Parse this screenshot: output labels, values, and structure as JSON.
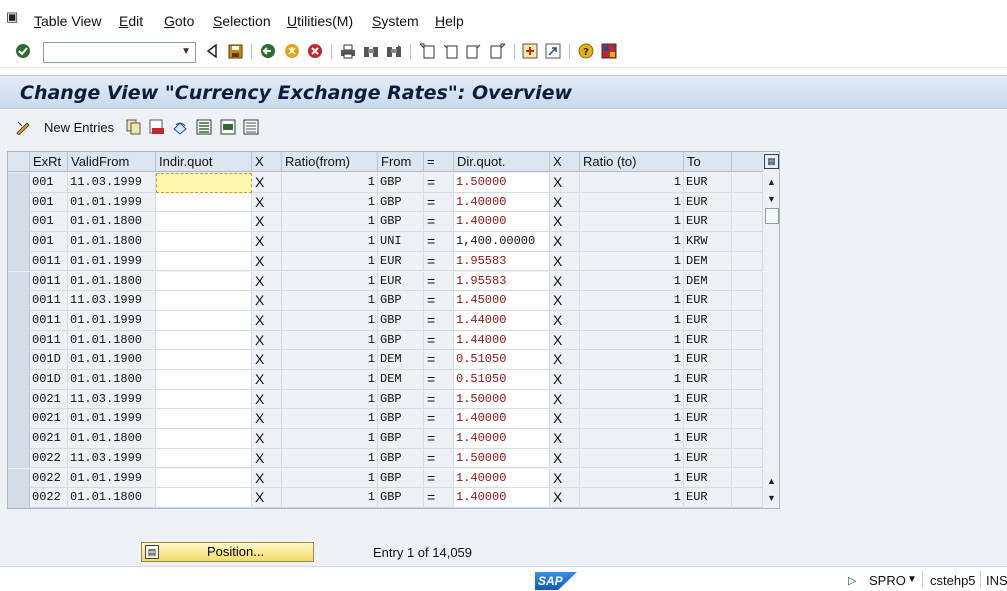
{
  "menu": {
    "items": [
      "Table View",
      "Edit",
      "Goto",
      "Selection",
      "Utilities(M)",
      "System",
      "Help"
    ]
  },
  "toolbar": {
    "command_value": "",
    "icons": [
      "enter-icon",
      "back-icon",
      "save-icon",
      "back-nav-icon",
      "exit-icon",
      "cancel-icon",
      "print-icon",
      "find-icon",
      "find-next-icon",
      "first-page-icon",
      "previous-page-icon",
      "next-page-icon",
      "last-page-icon",
      "create-session-icon",
      "shortcut-icon",
      "help-icon",
      "layout-icon"
    ]
  },
  "title": "Change View \"Currency Exchange Rates\": Overview",
  "app_toolbar": {
    "new_entries_label": "New Entries"
  },
  "table": {
    "headers": [
      "ExRt",
      "ValidFrom",
      "Indir.quot",
      "X",
      "Ratio(from)",
      "From",
      "=",
      "Dir.quot.",
      "X",
      "Ratio (to)",
      "To"
    ],
    "rows": [
      {
        "exrt": "001",
        "valid": "11.03.1999",
        "indir": "",
        "x1": "X",
        "ratio_from": "1",
        "from": "GBP",
        "eq": "=",
        "dir": "1.50000",
        "x2": "X",
        "ratio_to": "1",
        "to": "EUR"
      },
      {
        "exrt": "001",
        "valid": "01.01.1999",
        "indir": "",
        "x1": "X",
        "ratio_from": "1",
        "from": "GBP",
        "eq": "=",
        "dir": "1.40000",
        "x2": "X",
        "ratio_to": "1",
        "to": "EUR"
      },
      {
        "exrt": "001",
        "valid": "01.01.1800",
        "indir": "",
        "x1": "X",
        "ratio_from": "1",
        "from": "GBP",
        "eq": "=",
        "dir": "1.40000",
        "x2": "X",
        "ratio_to": "1",
        "to": "EUR"
      },
      {
        "exrt": "001",
        "valid": "01.01.1800",
        "indir": "",
        "x1": "X",
        "ratio_from": "1",
        "from": "UNI",
        "eq": "=",
        "dir": "1,400.00000",
        "x2": "X",
        "ratio_to": "1",
        "to": "KRW"
      },
      {
        "exrt": "0011",
        "valid": "01.01.1999",
        "indir": "",
        "x1": "X",
        "ratio_from": "1",
        "from": "EUR",
        "eq": "=",
        "dir": "1.95583",
        "x2": "X",
        "ratio_to": "1",
        "to": "DEM"
      },
      {
        "exrt": "0011",
        "valid": "01.01.1800",
        "indir": "",
        "x1": "X",
        "ratio_from": "1",
        "from": "EUR",
        "eq": "=",
        "dir": "1.95583",
        "x2": "X",
        "ratio_to": "1",
        "to": "DEM"
      },
      {
        "exrt": "0011",
        "valid": "11.03.1999",
        "indir": "",
        "x1": "X",
        "ratio_from": "1",
        "from": "GBP",
        "eq": "=",
        "dir": "1.45000",
        "x2": "X",
        "ratio_to": "1",
        "to": "EUR"
      },
      {
        "exrt": "0011",
        "valid": "01.01.1999",
        "indir": "",
        "x1": "X",
        "ratio_from": "1",
        "from": "GBP",
        "eq": "=",
        "dir": "1.44000",
        "x2": "X",
        "ratio_to": "1",
        "to": "EUR"
      },
      {
        "exrt": "0011",
        "valid": "01.01.1800",
        "indir": "",
        "x1": "X",
        "ratio_from": "1",
        "from": "GBP",
        "eq": "=",
        "dir": "1.44000",
        "x2": "X",
        "ratio_to": "1",
        "to": "EUR"
      },
      {
        "exrt": "001D",
        "valid": "01.01.1900",
        "indir": "",
        "x1": "X",
        "ratio_from": "1",
        "from": "DEM",
        "eq": "=",
        "dir": "0.51050",
        "x2": "X",
        "ratio_to": "1",
        "to": "EUR"
      },
      {
        "exrt": "001D",
        "valid": "01.01.1800",
        "indir": "",
        "x1": "X",
        "ratio_from": "1",
        "from": "DEM",
        "eq": "=",
        "dir": "0.51050",
        "x2": "X",
        "ratio_to": "1",
        "to": "EUR"
      },
      {
        "exrt": "0021",
        "valid": "11.03.1999",
        "indir": "",
        "x1": "X",
        "ratio_from": "1",
        "from": "GBP",
        "eq": "=",
        "dir": "1.50000",
        "x2": "X",
        "ratio_to": "1",
        "to": "EUR"
      },
      {
        "exrt": "0021",
        "valid": "01.01.1999",
        "indir": "",
        "x1": "X",
        "ratio_from": "1",
        "from": "GBP",
        "eq": "=",
        "dir": "1.40000",
        "x2": "X",
        "ratio_to": "1",
        "to": "EUR"
      },
      {
        "exrt": "0021",
        "valid": "01.01.1800",
        "indir": "",
        "x1": "X",
        "ratio_from": "1",
        "from": "GBP",
        "eq": "=",
        "dir": "1.40000",
        "x2": "X",
        "ratio_to": "1",
        "to": "EUR"
      },
      {
        "exrt": "0022",
        "valid": "11.03.1999",
        "indir": "",
        "x1": "X",
        "ratio_from": "1",
        "from": "GBP",
        "eq": "=",
        "dir": "1.50000",
        "x2": "X",
        "ratio_to": "1",
        "to": "EUR"
      },
      {
        "exrt": "0022",
        "valid": "01.01.1999",
        "indir": "",
        "x1": "X",
        "ratio_from": "1",
        "from": "GBP",
        "eq": "=",
        "dir": "1.40000",
        "x2": "X",
        "ratio_to": "1",
        "to": "EUR"
      },
      {
        "exrt": "0022",
        "valid": "01.01.1800",
        "indir": "",
        "x1": "X",
        "ratio_from": "1",
        "from": "GBP",
        "eq": "=",
        "dir": "1.40000",
        "x2": "X",
        "ratio_to": "1",
        "to": "EUR"
      }
    ]
  },
  "position_button": "Position...",
  "entry_text": "Entry 1 of 14,059",
  "status": {
    "transaction": "SPRO",
    "server": "cstehp5",
    "mode": "INS"
  },
  "colors": {
    "title_bar": "#c9d9ec",
    "work_area": "#eef2f7",
    "red_value": "#8b1414",
    "position_button": "#f3dc6a"
  }
}
